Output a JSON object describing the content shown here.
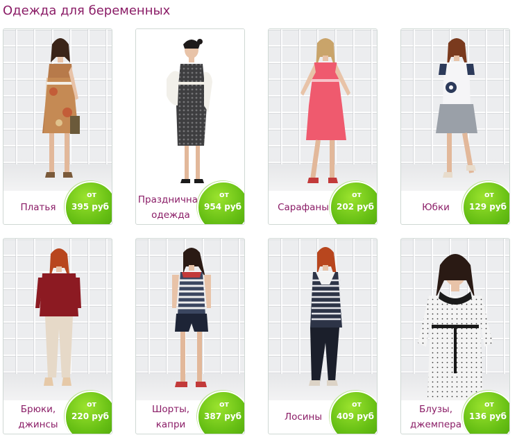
{
  "page": {
    "title": "Одежда для беременных"
  },
  "price_prefix": "от",
  "products": [
    {
      "name": "Платья",
      "price": "395 руб",
      "dress_color": "#b77a4a"
    },
    {
      "name": "Праздничная одежда",
      "price": "954 руб",
      "dress_color": "#3e3e40"
    },
    {
      "name": "Сарафаны",
      "price": "202 руб",
      "dress_color": "#ef5a6e"
    },
    {
      "name": "Юбки",
      "price": "129 руб",
      "dress_color": "#9aa0a8"
    },
    {
      "name": "Брюки, джинсы",
      "price": "220 руб",
      "dress_color": "#8c1a22"
    },
    {
      "name": "Шорты, капри",
      "price": "387 руб",
      "dress_color": "#3b4660"
    },
    {
      "name": "Лосины",
      "price": "409 руб",
      "dress_color": "#2d3447"
    },
    {
      "name": "Блузы, джемпера",
      "price": "136 руб",
      "dress_color": "#f4f4f4"
    }
  ],
  "colors": {
    "title": "#8a1c66",
    "badge": "#66bf14",
    "border": "#cfd8d4"
  }
}
